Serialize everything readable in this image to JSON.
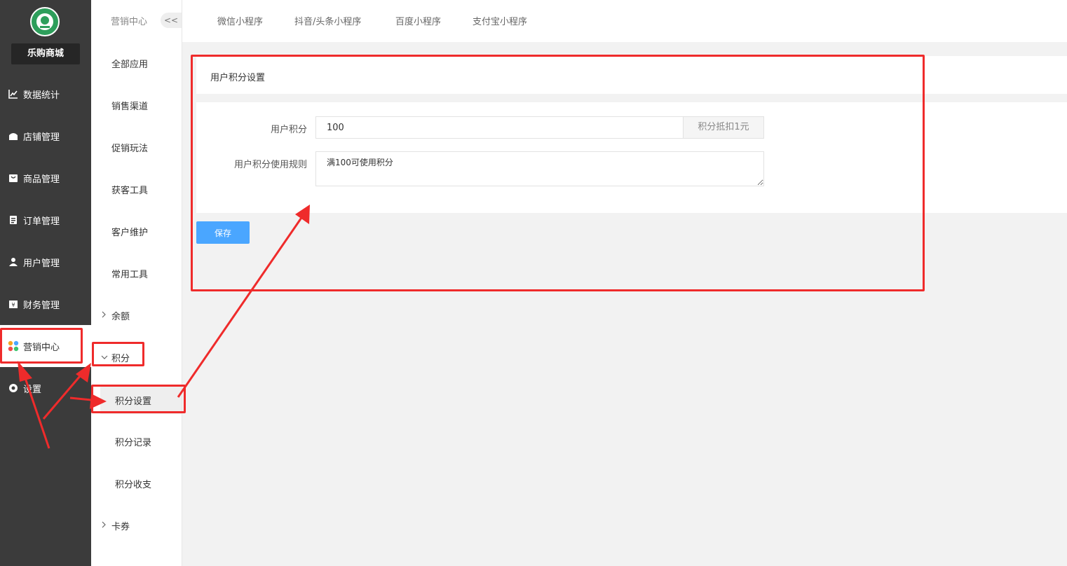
{
  "sidebar": {
    "shop_name": "乐购商城",
    "items": [
      {
        "label": "数据统计",
        "icon": "chart-line-icon"
      },
      {
        "label": "店铺管理",
        "icon": "shop-icon"
      },
      {
        "label": "商品管理",
        "icon": "goods-icon"
      },
      {
        "label": "订单管理",
        "icon": "clipboard-icon"
      },
      {
        "label": "用户管理",
        "icon": "user-icon"
      },
      {
        "label": "财务管理",
        "icon": "finance-icon"
      },
      {
        "label": "营销中心",
        "icon": "marketing-icon",
        "active": true
      },
      {
        "label": "设置",
        "icon": "gear-icon"
      }
    ]
  },
  "submenu": {
    "title": "营销中心",
    "collapse_label": "<<",
    "items": [
      {
        "label": "全部应用"
      },
      {
        "label": "销售渠道"
      },
      {
        "label": "促销玩法"
      },
      {
        "label": "获客工具"
      },
      {
        "label": "客户维护"
      },
      {
        "label": "常用工具"
      },
      {
        "label": "余额",
        "expandable": true
      },
      {
        "label": "积分",
        "expandable": true,
        "expanded": true
      },
      {
        "label": "积分设置",
        "child": true,
        "selected": true
      },
      {
        "label": "积分记录",
        "child": true
      },
      {
        "label": "积分收支",
        "child": true
      },
      {
        "label": "卡券",
        "expandable": true
      }
    ]
  },
  "tabs": [
    "微信小程序",
    "抖音/头条小程序",
    "百度小程序",
    "支付宝小程序"
  ],
  "panel": {
    "title": "用户积分设置",
    "points_label": "用户积分",
    "points_value": "100",
    "points_suffix": "积分抵扣1元",
    "rule_label": "用户积分使用规则",
    "rule_value": "满100可使用积分",
    "save_label": "保存"
  },
  "colors": {
    "sidebar_bg": "#3b3b3b",
    "primary": "#4aa6ff",
    "annotation": "#ef2b2b"
  }
}
